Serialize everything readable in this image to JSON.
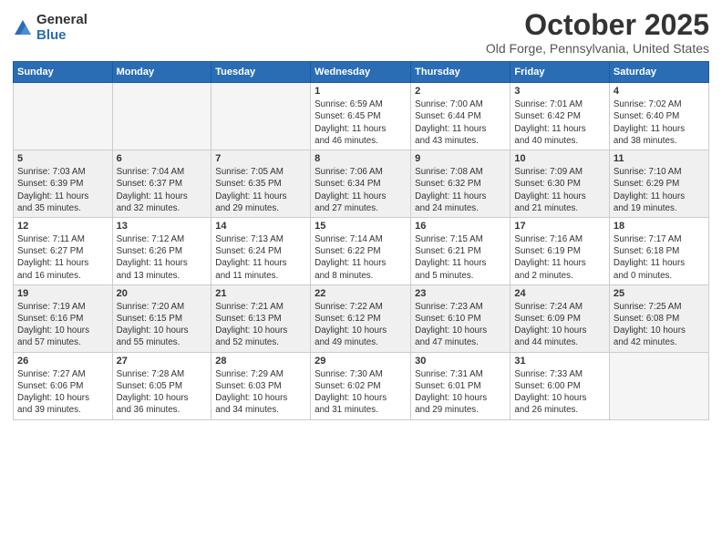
{
  "logo": {
    "general": "General",
    "blue": "Blue"
  },
  "title": "October 2025",
  "subtitle": "Old Forge, Pennsylvania, United States",
  "days_of_week": [
    "Sunday",
    "Monday",
    "Tuesday",
    "Wednesday",
    "Thursday",
    "Friday",
    "Saturday"
  ],
  "weeks": [
    [
      {
        "day": "",
        "info": ""
      },
      {
        "day": "",
        "info": ""
      },
      {
        "day": "",
        "info": ""
      },
      {
        "day": "1",
        "info": "Sunrise: 6:59 AM\nSunset: 6:45 PM\nDaylight: 11 hours\nand 46 minutes."
      },
      {
        "day": "2",
        "info": "Sunrise: 7:00 AM\nSunset: 6:44 PM\nDaylight: 11 hours\nand 43 minutes."
      },
      {
        "day": "3",
        "info": "Sunrise: 7:01 AM\nSunset: 6:42 PM\nDaylight: 11 hours\nand 40 minutes."
      },
      {
        "day": "4",
        "info": "Sunrise: 7:02 AM\nSunset: 6:40 PM\nDaylight: 11 hours\nand 38 minutes."
      }
    ],
    [
      {
        "day": "5",
        "info": "Sunrise: 7:03 AM\nSunset: 6:39 PM\nDaylight: 11 hours\nand 35 minutes."
      },
      {
        "day": "6",
        "info": "Sunrise: 7:04 AM\nSunset: 6:37 PM\nDaylight: 11 hours\nand 32 minutes."
      },
      {
        "day": "7",
        "info": "Sunrise: 7:05 AM\nSunset: 6:35 PM\nDaylight: 11 hours\nand 29 minutes."
      },
      {
        "day": "8",
        "info": "Sunrise: 7:06 AM\nSunset: 6:34 PM\nDaylight: 11 hours\nand 27 minutes."
      },
      {
        "day": "9",
        "info": "Sunrise: 7:08 AM\nSunset: 6:32 PM\nDaylight: 11 hours\nand 24 minutes."
      },
      {
        "day": "10",
        "info": "Sunrise: 7:09 AM\nSunset: 6:30 PM\nDaylight: 11 hours\nand 21 minutes."
      },
      {
        "day": "11",
        "info": "Sunrise: 7:10 AM\nSunset: 6:29 PM\nDaylight: 11 hours\nand 19 minutes."
      }
    ],
    [
      {
        "day": "12",
        "info": "Sunrise: 7:11 AM\nSunset: 6:27 PM\nDaylight: 11 hours\nand 16 minutes."
      },
      {
        "day": "13",
        "info": "Sunrise: 7:12 AM\nSunset: 6:26 PM\nDaylight: 11 hours\nand 13 minutes."
      },
      {
        "day": "14",
        "info": "Sunrise: 7:13 AM\nSunset: 6:24 PM\nDaylight: 11 hours\nand 11 minutes."
      },
      {
        "day": "15",
        "info": "Sunrise: 7:14 AM\nSunset: 6:22 PM\nDaylight: 11 hours\nand 8 minutes."
      },
      {
        "day": "16",
        "info": "Sunrise: 7:15 AM\nSunset: 6:21 PM\nDaylight: 11 hours\nand 5 minutes."
      },
      {
        "day": "17",
        "info": "Sunrise: 7:16 AM\nSunset: 6:19 PM\nDaylight: 11 hours\nand 2 minutes."
      },
      {
        "day": "18",
        "info": "Sunrise: 7:17 AM\nSunset: 6:18 PM\nDaylight: 11 hours\nand 0 minutes."
      }
    ],
    [
      {
        "day": "19",
        "info": "Sunrise: 7:19 AM\nSunset: 6:16 PM\nDaylight: 10 hours\nand 57 minutes."
      },
      {
        "day": "20",
        "info": "Sunrise: 7:20 AM\nSunset: 6:15 PM\nDaylight: 10 hours\nand 55 minutes."
      },
      {
        "day": "21",
        "info": "Sunrise: 7:21 AM\nSunset: 6:13 PM\nDaylight: 10 hours\nand 52 minutes."
      },
      {
        "day": "22",
        "info": "Sunrise: 7:22 AM\nSunset: 6:12 PM\nDaylight: 10 hours\nand 49 minutes."
      },
      {
        "day": "23",
        "info": "Sunrise: 7:23 AM\nSunset: 6:10 PM\nDaylight: 10 hours\nand 47 minutes."
      },
      {
        "day": "24",
        "info": "Sunrise: 7:24 AM\nSunset: 6:09 PM\nDaylight: 10 hours\nand 44 minutes."
      },
      {
        "day": "25",
        "info": "Sunrise: 7:25 AM\nSunset: 6:08 PM\nDaylight: 10 hours\nand 42 minutes."
      }
    ],
    [
      {
        "day": "26",
        "info": "Sunrise: 7:27 AM\nSunset: 6:06 PM\nDaylight: 10 hours\nand 39 minutes."
      },
      {
        "day": "27",
        "info": "Sunrise: 7:28 AM\nSunset: 6:05 PM\nDaylight: 10 hours\nand 36 minutes."
      },
      {
        "day": "28",
        "info": "Sunrise: 7:29 AM\nSunset: 6:03 PM\nDaylight: 10 hours\nand 34 minutes."
      },
      {
        "day": "29",
        "info": "Sunrise: 7:30 AM\nSunset: 6:02 PM\nDaylight: 10 hours\nand 31 minutes."
      },
      {
        "day": "30",
        "info": "Sunrise: 7:31 AM\nSunset: 6:01 PM\nDaylight: 10 hours\nand 29 minutes."
      },
      {
        "day": "31",
        "info": "Sunrise: 7:33 AM\nSunset: 6:00 PM\nDaylight: 10 hours\nand 26 minutes."
      },
      {
        "day": "",
        "info": ""
      }
    ]
  ]
}
